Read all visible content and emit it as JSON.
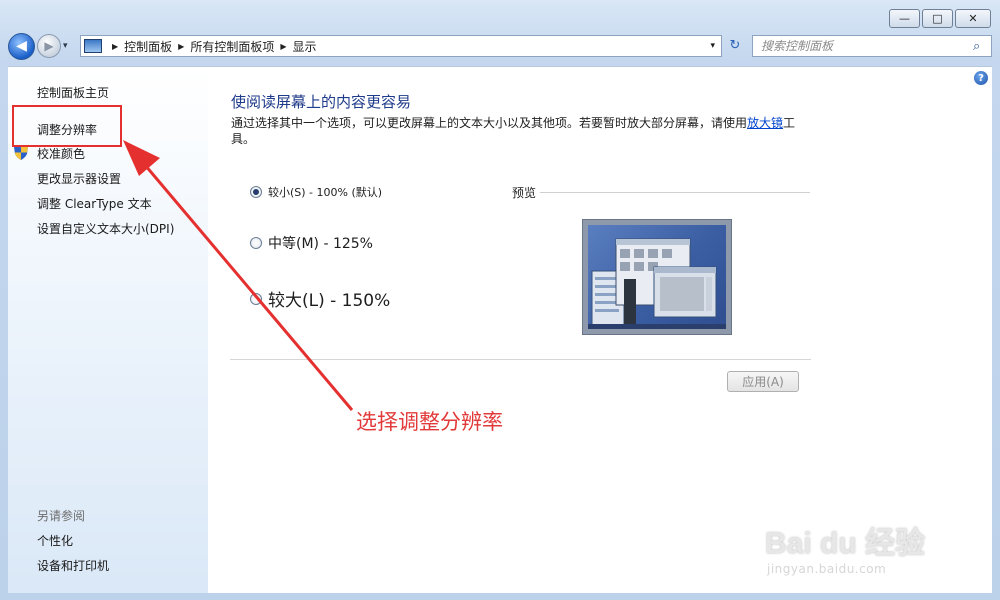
{
  "window": {
    "caption_buttons": {
      "minimize": "—",
      "maximize": "□",
      "close": "✕"
    }
  },
  "nav": {
    "back_glyph": "◀",
    "forward_glyph": "▶",
    "history_glyph": "▾",
    "breadcrumbs": [
      "控制面板",
      "所有控制面板项",
      "显示"
    ],
    "separator_glyph": "▶",
    "address_drop_glyph": "▾",
    "refresh_glyph": "↻",
    "search_placeholder": "搜索控制面板",
    "search_glyph": "⌕"
  },
  "sidebar": {
    "items": [
      {
        "label": "控制面板主页"
      },
      {
        "label": "调整分辨率"
      },
      {
        "label": "校准颜色"
      },
      {
        "label": "更改显示器设置"
      },
      {
        "label": "调整 ClearType 文本"
      },
      {
        "label": "设置自定义文本大小(DPI)"
      }
    ],
    "see_also_title": "另请参阅",
    "see_also": [
      {
        "label": "个性化"
      },
      {
        "label": "设备和打印机"
      }
    ]
  },
  "main": {
    "help_glyph": "?",
    "title": "使阅读屏幕上的内容更容易",
    "description_before": "通过选择其中一个选项，可以更改屏幕上的文本大小以及其他项。若要暂时放大部分屏幕，请使用",
    "description_link": "放大镜",
    "description_after": "工具。",
    "options": [
      {
        "label": "较小(S) - 100% (默认)",
        "selected": true
      },
      {
        "label": "中等(M) - 125%",
        "selected": false
      },
      {
        "label": "较大(L) - 150%",
        "selected": false
      }
    ],
    "preview_label": "预览",
    "apply_label": "应用(A)"
  },
  "annotation": {
    "text": "选择调整分辨率",
    "color": "#e53030"
  },
  "watermark": {
    "brand": "Bai du 经验",
    "url": "jingyan.baidu.com"
  }
}
